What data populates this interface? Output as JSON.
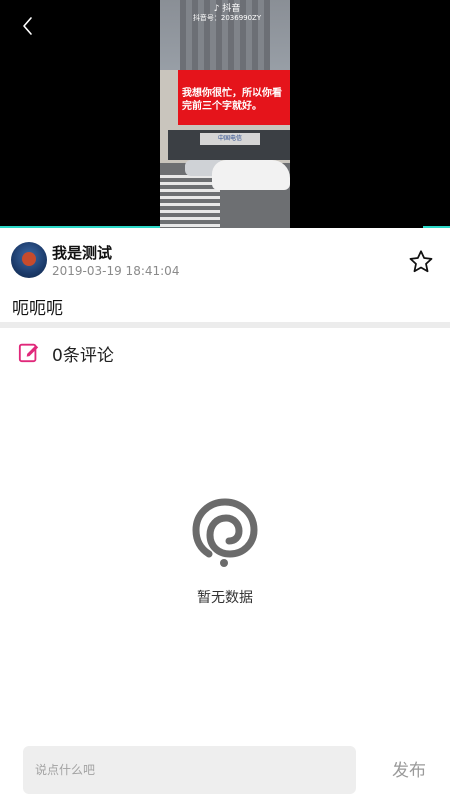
{
  "video": {
    "watermark_app": "♪ 抖音",
    "watermark_id": "抖音号：2036990ZY",
    "billboard_text": "我想你很忙，所以你看完前三个字就好。",
    "store_sign": "中国电信",
    "colors": {
      "progress": "#2bd9c8",
      "billboard": "#e5141b"
    }
  },
  "icons": {
    "back": "chevron-left-icon",
    "favorite": "star-outline-icon",
    "comment": "edit-icon",
    "empty": "spiral-empty-icon"
  },
  "author": {
    "name": "我是测试",
    "timestamp": "2019-03-19 18:41:04"
  },
  "post": {
    "text": "呃呃呃"
  },
  "comments": {
    "count_label": "0条评论",
    "empty_text": "暂无数据",
    "accent_color": "#e0287a"
  },
  "composer": {
    "placeholder": "说点什么吧",
    "publish_label": "发布"
  }
}
